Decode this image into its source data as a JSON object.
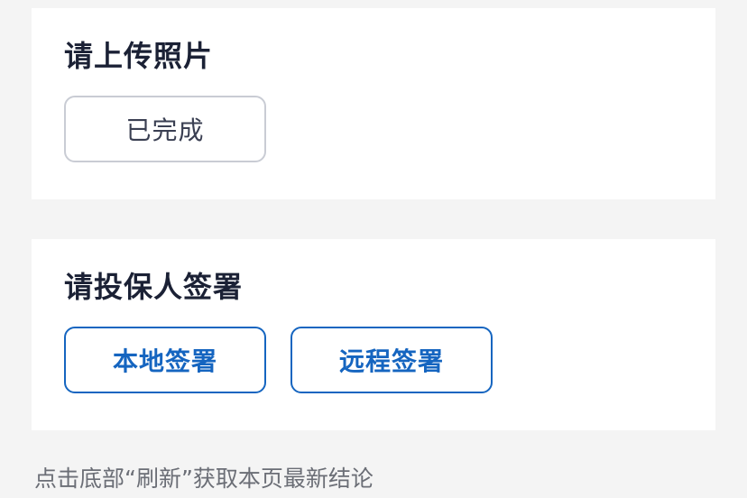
{
  "upload_section": {
    "title": "请上传照片",
    "status_button_label": "已完成"
  },
  "sign_section": {
    "title": "请投保人签署",
    "local_sign_label": "本地签署",
    "remote_sign_label": "远程签署"
  },
  "footer": {
    "hint": "点击底部“刷新”获取本页最新结论"
  },
  "colors": {
    "accent": "#1565c0",
    "background": "#f4f4f4",
    "card": "#ffffff",
    "title_text": "#1b2135",
    "muted_border": "#c9ccd4"
  }
}
